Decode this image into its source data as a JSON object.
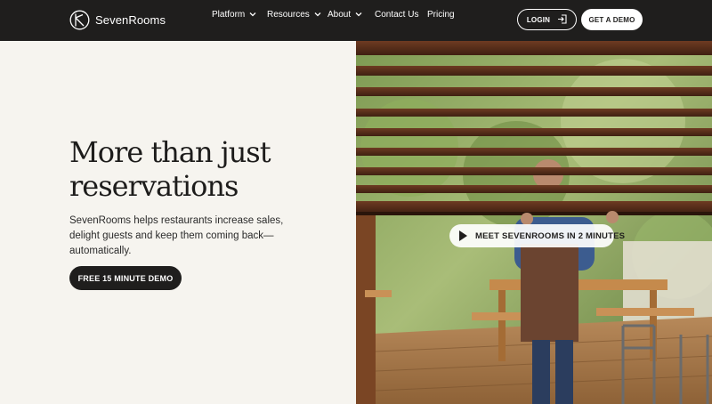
{
  "header": {
    "brand_name": "SevenRooms",
    "nav": [
      {
        "label": "Platform",
        "has_dropdown": true
      },
      {
        "label": "Resources",
        "has_dropdown": true
      },
      {
        "label": "About",
        "has_dropdown": true
      },
      {
        "label": "Contact Us",
        "has_dropdown": false
      },
      {
        "label": "Pricing",
        "has_dropdown": false
      }
    ],
    "login_label": "LOGIN",
    "demo_label": "GET A DEMO"
  },
  "hero": {
    "title_line1": "More than just",
    "title_line2": "reservations",
    "subtitle": "SevenRooms helps restaurants increase sales, delight guests and keep them coming back—automatically.",
    "cta_label": "FREE 15 MINUTE DEMO",
    "video_label": "MEET SEVENROOMS IN 2 MINUTES"
  },
  "colors": {
    "header_bg": "#1f1e1d",
    "page_bg": "#f6f4ef",
    "text_dark": "#1d1c1b",
    "button_dark": "#1f1e1d",
    "button_light": "#ffffff"
  },
  "icons": {
    "logo": "sevenrooms-logo-icon",
    "login": "login-arrow-icon",
    "dropdown": "chevron-down-icon",
    "video": "play-icon"
  }
}
